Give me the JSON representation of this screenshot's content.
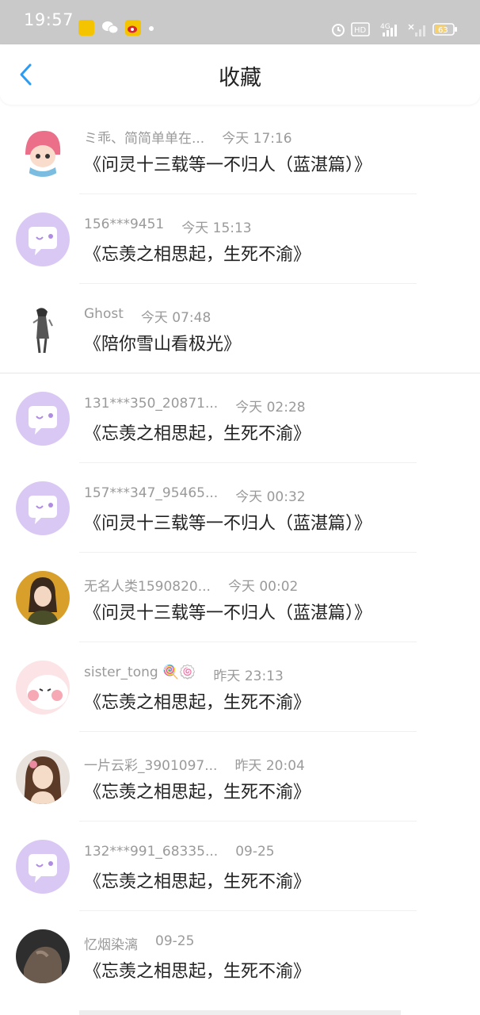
{
  "status_bar": {
    "time": "19:57",
    "network": "4G",
    "battery": "63"
  },
  "header": {
    "title": "收藏",
    "back_icon": "chevron-left-icon",
    "accent_color": "#2b9cf2"
  },
  "favorites": [
    {
      "user": "ミ乖、简简单单在...",
      "time": "今天 17:16",
      "title": "《问灵十三载等一不归人（蓝湛篇）》",
      "avatar": "cartoon-girl"
    },
    {
      "user": "156***9451",
      "time": "今天 15:13",
      "title": "《忘羡之相思起，生死不渝》",
      "avatar": "chat-bubble"
    },
    {
      "user": "Ghost ",
      "time": "今天 07:48",
      "title": "《陪你雪山看极光》",
      "avatar": "sketch-figure"
    },
    {
      "user": "131***350_20871...",
      "time": "今天 02:28",
      "title": "《忘羡之相思起，生死不渝》",
      "avatar": "chat-bubble"
    },
    {
      "user": "157***347_95465...",
      "time": "今天 00:32",
      "title": "《问灵十三载等一不归人（蓝湛篇）》",
      "avatar": "chat-bubble"
    },
    {
      "user": "无名人类1590820...",
      "time": "今天 00:02",
      "title": "《问灵十三载等一不归人（蓝湛篇）》",
      "avatar": "girl-photo"
    },
    {
      "user": "sister_tong 🍭🍥",
      "time": "昨天 23:13",
      "title": "《忘羡之相思起，生死不渝》",
      "avatar": "pink-cartoon"
    },
    {
      "user": "一片云彩_3901097...",
      "time": "昨天 20:04",
      "title": "《忘羡之相思起，生死不渝》",
      "avatar": "woman-portrait"
    },
    {
      "user": "132***991_68335...",
      "time": "09-25",
      "title": "《忘羡之相思起，生死不渝》",
      "avatar": "chat-bubble"
    },
    {
      "user": "忆烟染漓",
      "time": "09-25",
      "title": "《忘羡之相思起，生死不渝》",
      "avatar": "dark-photo"
    }
  ]
}
